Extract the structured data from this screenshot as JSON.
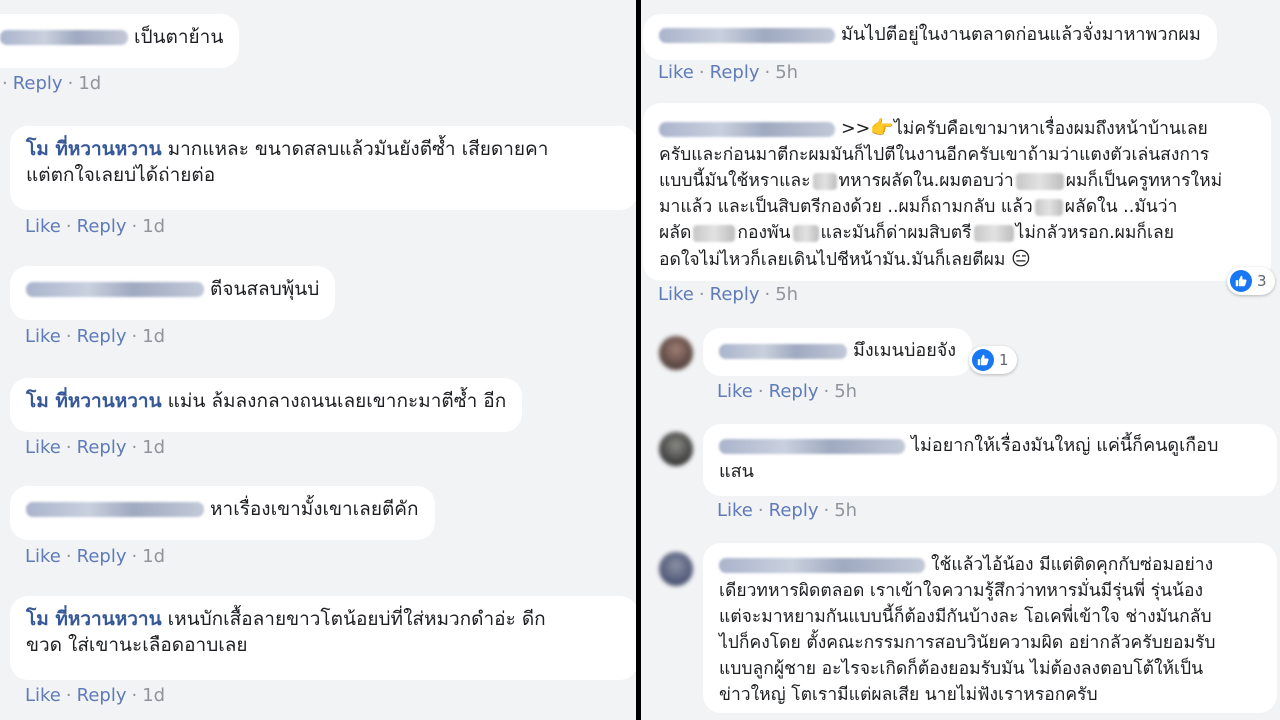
{
  "left": {
    "comments": [
      {
        "text": "เป็นตาย้าน",
        "actions": {
          "reply": "Reply",
          "age": "1d"
        }
      },
      {
        "author": "โม ที่หวานหวาน",
        "line1": "มากแหละ ขนาดสลบแล้วมันยังตีซ้ำ เสียดายคา",
        "line2": "แต่ตกใจเลยบ่ได้ถ่ายต่อ",
        "actions": {
          "like": "Like",
          "reply": "Reply",
          "age": "1d"
        }
      },
      {
        "text": "ตีจนสลบพุ้นบ่",
        "actions": {
          "like": "Like",
          "reply": "Reply",
          "age": "1d"
        }
      },
      {
        "author": "โม ที่หวานหวาน",
        "text": "แม่น ล้มลงกลางถนนเลยเขากะมาตีซ้ำ อีก",
        "actions": {
          "like": "Like",
          "reply": "Reply",
          "age": "1d"
        }
      },
      {
        "text": "หาเรื่องเขามั้งเขาเลยตีคัก",
        "actions": {
          "like": "Like",
          "reply": "Reply",
          "age": "1d"
        }
      },
      {
        "author": "โม ที่หวานหวาน",
        "line1": "เหนบักเสื้อลายขาวโตน้อยบ่ที่ใส่หมวกดำอ่ะ ดีก",
        "line2": "ขวด ใส่เขานะเลือดอาบเลย",
        "actions": {
          "like": "Like",
          "reply": "Reply",
          "age": "1d"
        }
      }
    ]
  },
  "right": {
    "comments": [
      {
        "text": "มันไปตีอยู่ในงานตลาดก่อนแล้วจั่งมาหาพวกผม",
        "actions": {
          "like": "Like",
          "reply": "Reply",
          "age": "5h"
        }
      },
      {
        "line1a": ">>",
        "line1b": "ไม่ครับคือเขามาหาเรื่องผมถึงหน้าบ้านเลย",
        "line2": "ครับและก่อนมาตีกะผมมันก็ไปตีในงานอีกครับเขาถ้ามว่าแตงตัวเล่นสงการ",
        "line3a": "แบบนี้มันใช้หราและ",
        "line3b": "ทหารผลัดใน.ผมตอบว่า",
        "line3c": "ผมก็เป็นครูทหารใหม่",
        "line4a": "มาแล้ว และเป็นสิบตรีกองด้วย ..ผมก็ถามกลับ แล้ว",
        "line4b": "ผลัดใน ..มันว่า",
        "line5a": "ผลัด",
        "line5b": "กองพัน",
        "line5c": "และมันก็ด่าผมสิบตรี",
        "line5d": "ไม่กลัวหรอก.ผมก็เลย",
        "line6": "อดใจไม่ไหวก็เลยเดินไปชีหน้ามัน.มันก็เลยตีผม",
        "reaction_count": "3",
        "actions": {
          "like": "Like",
          "reply": "Reply",
          "age": "5h"
        }
      },
      {
        "text": "มึงเมนบ่อยจัง",
        "reaction_count": "1",
        "actions": {
          "like": "Like",
          "reply": "Reply",
          "age": "5h"
        }
      },
      {
        "line1": "ไม่อยากให้เรื่องมันใหญ่ แค่นี้ก็คนดูเกือบ",
        "line2": "แสน",
        "actions": {
          "like": "Like",
          "reply": "Reply",
          "age": "5h"
        }
      },
      {
        "line1": "ใช้แล้วไอ้น้อง มีแต่ติดคุกกับซ่อมอย่าง",
        "line2": "เดียวทหารผิดตลอด เราเข้าใจความรู้สึกว่าทหารมั่นมีรุ่นพี่ รุ่นน้อง",
        "line3": "แต่จะมาหยามกันแบบนี้ก็ต้องมีกันบ้างละ โอเคพี่เข้าใจ ช่างมันกลับ",
        "line4": "ไปก็คงโดย ตั้งคณะกรรมการสอบวินัยความผิด อย่ากลัวครับยอมรับ",
        "line5": "แบบลูกผู้ชาย อะไรจะเกิดก็ต้องยอมรับมัน ไม่ต้องลงตอบโต้ให้เป็น",
        "line6": "ข่าวใหญ่ โตเรามีแต่ผลเสีย นายไม่ฟังเราหรอกครับ"
      }
    ]
  },
  "colors": {
    "name": "#365899",
    "link": "#5f7bb8",
    "meta": "#90949c",
    "bubble": "#ffffff",
    "background": "#f2f3f5",
    "like_blue": "#1877f2",
    "divider": "#000000"
  },
  "icons": [
    "thumbs-up-icon",
    "pointing-hand-emoji",
    "neutral-face-emoji"
  ]
}
